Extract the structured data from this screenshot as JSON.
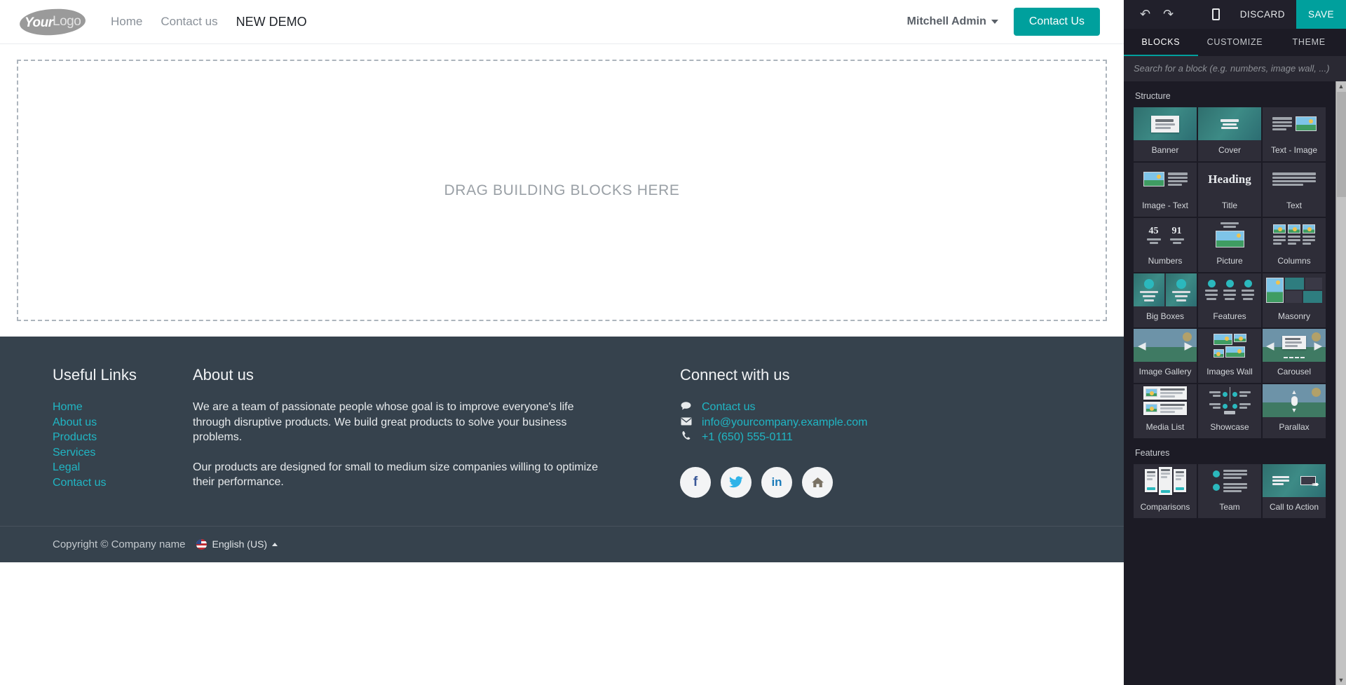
{
  "site": {
    "logo": {
      "part1": "Your",
      "part2": "Logo"
    },
    "nav": [
      {
        "label": "Home",
        "current": false
      },
      {
        "label": "Contact us",
        "current": false
      },
      {
        "label": "NEW DEMO",
        "current": true
      }
    ],
    "user_menu": "Mitchell Admin",
    "cta_button": "Contact Us",
    "dropzone_text": "DRAG BUILDING BLOCKS HERE"
  },
  "footer": {
    "links_title": "Useful Links",
    "links": [
      "Home",
      "About us",
      "Products",
      "Services",
      "Legal",
      "Contact us"
    ],
    "about_title": "About us",
    "about_paragraphs": [
      "We are a team of passionate people whose goal is to improve everyone's life through disruptive products. We build great products to solve your business problems.",
      "Our products are designed for small to medium size companies willing to optimize their performance."
    ],
    "connect_title": "Connect with us",
    "contacts": [
      {
        "icon": "comment-icon",
        "glyph": "●",
        "label": "Contact us"
      },
      {
        "icon": "envelope-icon",
        "glyph": "✉",
        "label": "info@yourcompany.example.com"
      },
      {
        "icon": "phone-icon",
        "glyph": "☎",
        "label": "+1 (650) 555-0111"
      }
    ],
    "socials": [
      {
        "name": "facebook-icon",
        "glyph": "f"
      },
      {
        "name": "twitter-icon",
        "glyph": "ᴠ"
      },
      {
        "name": "linkedin-icon",
        "glyph": "in"
      },
      {
        "name": "home-icon",
        "glyph": "⌂"
      }
    ],
    "copyright": "Copyright © Company name",
    "language": "English (US)"
  },
  "editor": {
    "toolbar": {
      "undo": "↶",
      "redo": "↷",
      "mobile_preview": "mobile-preview-icon",
      "discard": "DISCARD",
      "save": "SAVE"
    },
    "tabs": [
      {
        "label": "BLOCKS",
        "active": true
      },
      {
        "label": "CUSTOMIZE",
        "active": false
      },
      {
        "label": "THEME",
        "active": false
      }
    ],
    "search_placeholder": "Search for a block (e.g. numbers, image wall, ...)",
    "sections": [
      {
        "title": "Structure",
        "blocks": [
          {
            "label": "Banner",
            "thumb": "banner"
          },
          {
            "label": "Cover",
            "thumb": "cover"
          },
          {
            "label": "Text - Image",
            "thumb": "text-image"
          },
          {
            "label": "Image - Text",
            "thumb": "image-text"
          },
          {
            "label": "Title",
            "thumb": "title"
          },
          {
            "label": "Text",
            "thumb": "text"
          },
          {
            "label": "Numbers",
            "thumb": "numbers"
          },
          {
            "label": "Picture",
            "thumb": "picture"
          },
          {
            "label": "Columns",
            "thumb": "columns"
          },
          {
            "label": "Big Boxes",
            "thumb": "big-boxes"
          },
          {
            "label": "Features",
            "thumb": "features"
          },
          {
            "label": "Masonry",
            "thumb": "masonry"
          },
          {
            "label": "Image Gallery",
            "thumb": "image-gallery"
          },
          {
            "label": "Images Wall",
            "thumb": "images-wall"
          },
          {
            "label": "Carousel",
            "thumb": "carousel"
          },
          {
            "label": "Media List",
            "thumb": "media-list"
          },
          {
            "label": "Showcase",
            "thumb": "showcase"
          },
          {
            "label": "Parallax",
            "thumb": "parallax"
          }
        ]
      },
      {
        "title": "Features",
        "blocks": [
          {
            "label": "Comparisons",
            "thumb": "comparisons"
          },
          {
            "label": "Team",
            "thumb": "team"
          },
          {
            "label": "Call to Action",
            "thumb": "call-to-action"
          }
        ]
      }
    ],
    "title_thumb_text": "Heading",
    "numbers_thumb": [
      "45",
      "91"
    ],
    "colors": {
      "accent": "#00A09D",
      "panel_bg": "#1c1b25",
      "card_bg": "#2e2d38",
      "footer_bg": "#36424d",
      "link": "#20b6c4"
    }
  }
}
